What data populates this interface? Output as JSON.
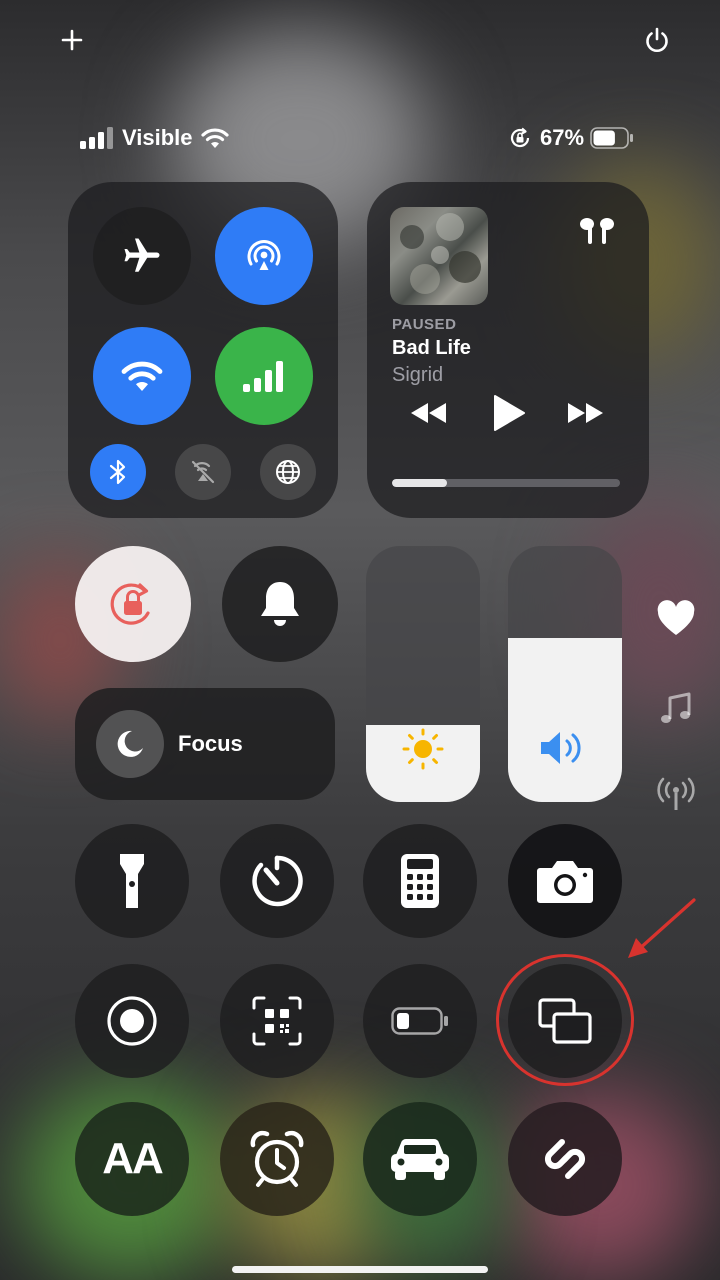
{
  "top": {
    "add_icon": "plus-icon",
    "power_icon": "power-icon"
  },
  "status_bar": {
    "carrier": "Visible",
    "battery_percent": "67%",
    "battery_level": 0.67
  },
  "connectivity": {
    "airplane_icon": "airplane-icon",
    "airdrop_icon": "airdrop-icon",
    "wifi_icon": "wifi-icon",
    "cellular_icon": "cellular-icon",
    "bluetooth_icon": "bluetooth-icon",
    "no_satellite_icon": "satellite-off-icon",
    "globe_icon": "globe-icon"
  },
  "now_playing": {
    "status": "PAUSED",
    "title": "Bad Life",
    "artist": "Sigrid",
    "progress": 0.24,
    "output_icon": "airpods-icon"
  },
  "focus": {
    "label": "Focus"
  },
  "sliders": {
    "brightness_level": 0.3,
    "volume_level": 0.64
  },
  "side_shortcuts": [
    "heart-icon",
    "music-note-icon",
    "antenna-icon"
  ],
  "colors": {
    "blue": "#2f7cf6",
    "green": "#3ab44a",
    "highlight": "#d8332e",
    "brightness_icon": "#f7b500",
    "volume_icon": "#3b8ff0"
  },
  "controls_row1": [
    "flashlight-icon",
    "timer-icon",
    "calculator-icon",
    "camera-icon"
  ],
  "controls_row2": [
    "screen-record-icon",
    "qr-scanner-icon",
    "low-power-icon",
    "screen-mirroring-icon"
  ],
  "controls_row3": [
    "text-size-icon",
    "alarm-icon",
    "car-icon",
    "shazam-icon"
  ],
  "text_size_label": "AA"
}
